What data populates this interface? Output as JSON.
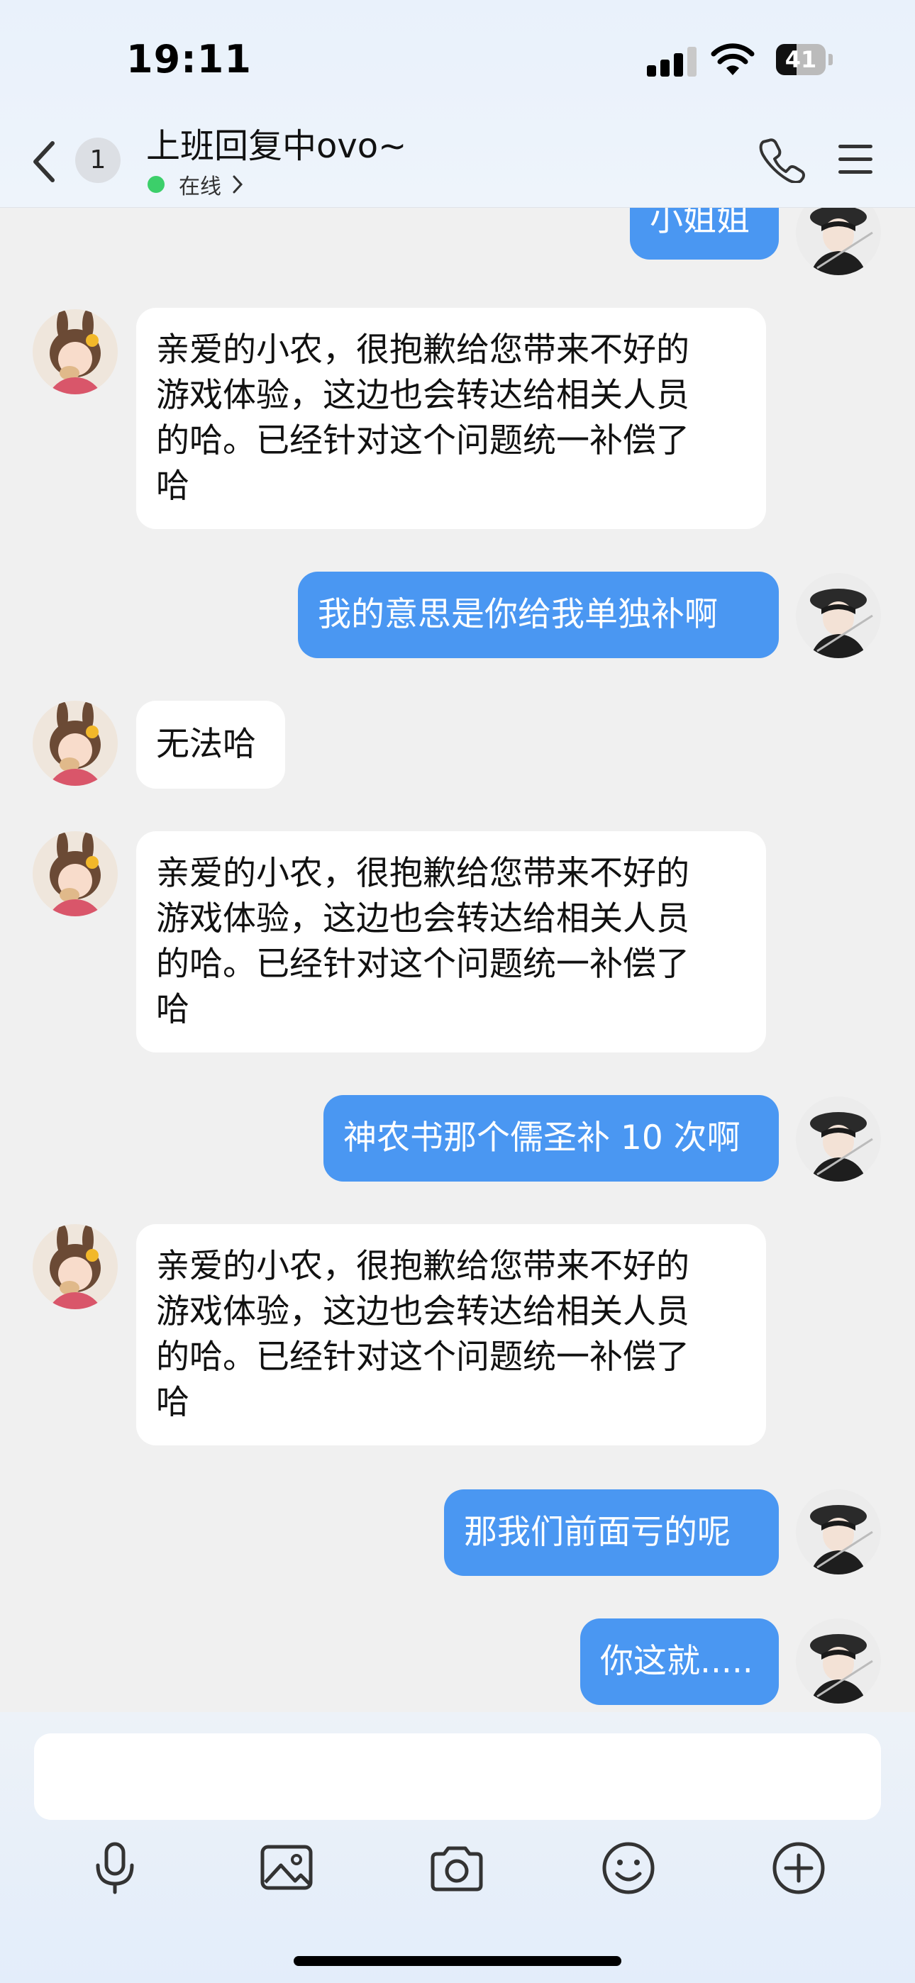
{
  "status_bar": {
    "time": "19:11",
    "battery": "41",
    "battery_level": 0.41,
    "icons": [
      "signal-icon",
      "wifi-icon",
      "battery-icon"
    ]
  },
  "header": {
    "unread_count": "1",
    "title": "上班回复中ovo~",
    "status": "在线",
    "icons": [
      "back-icon",
      "phone-icon",
      "menu-icon"
    ]
  },
  "messages": [
    {
      "side": "out",
      "lines": [
        "小姐姐"
      ]
    },
    {
      "side": "in",
      "lines": [
        "亲爱的小农，很抱歉给您带来不好的",
        "游戏体验，这边也会转达给相关人员",
        "的哈。已经针对这个问题统一补偿了",
        "哈"
      ]
    },
    {
      "side": "out",
      "lines": [
        "我的意思是你给我单独补啊"
      ]
    },
    {
      "side": "in",
      "lines": [
        "无法哈"
      ]
    },
    {
      "side": "in",
      "lines": [
        "亲爱的小农，很抱歉给您带来不好的",
        "游戏体验，这边也会转达给相关人员",
        "的哈。已经针对这个问题统一补偿了",
        "哈"
      ]
    },
    {
      "side": "out",
      "lines": [
        "神农书那个儒圣补 10 次啊"
      ]
    },
    {
      "side": "in",
      "lines": [
        "亲爱的小农，很抱歉给您带来不好的",
        "游戏体验，这边也会转达给相关人员",
        "的哈。已经针对这个问题统一补偿了",
        "哈"
      ]
    },
    {
      "side": "out",
      "lines": [
        "那我们前面亏的呢"
      ]
    },
    {
      "side": "out",
      "lines": [
        "你这就....."
      ]
    }
  ],
  "composer": {
    "input_value": "",
    "tools": [
      "microphone-icon",
      "image-icon",
      "camera-icon",
      "emoji-icon",
      "plus-icon"
    ]
  },
  "colors": {
    "outgoing_bubble": "#4a97f2",
    "incoming_bubble": "#ffffff",
    "online_dot": "#3ccf6a",
    "chat_background": "#f0f0f0"
  }
}
